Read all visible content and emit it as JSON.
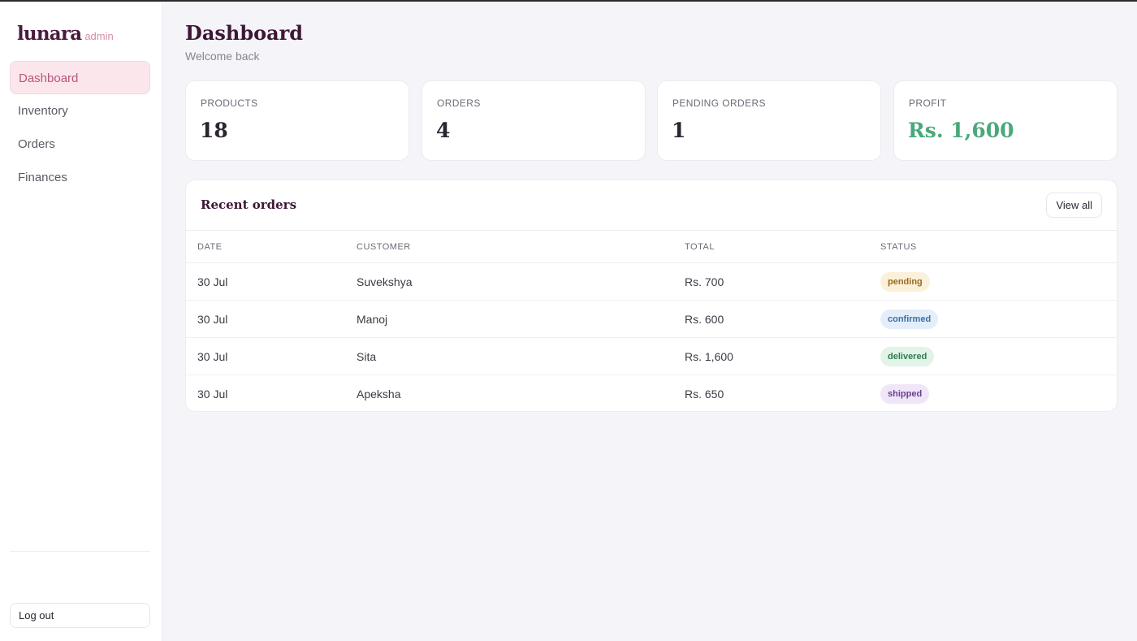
{
  "brand": {
    "name": "lunara",
    "tag": "admin"
  },
  "sidebar": {
    "items": [
      {
        "label": "Dashboard",
        "active": true
      },
      {
        "label": "Inventory",
        "active": false
      },
      {
        "label": "Orders",
        "active": false
      },
      {
        "label": "Finances",
        "active": false
      }
    ],
    "logout_label": "Log out"
  },
  "header": {
    "title": "Dashboard",
    "subtitle": "Welcome back"
  },
  "stats": [
    {
      "label": "PRODUCTS",
      "value": "18"
    },
    {
      "label": "ORDERS",
      "value": "4"
    },
    {
      "label": "PENDING ORDERS",
      "value": "1"
    },
    {
      "label": "PROFIT",
      "value": "Rs. 1,600",
      "color": "#4aa87a"
    }
  ],
  "recent_orders": {
    "title": "Recent orders",
    "view_all_label": "View all",
    "columns": [
      "DATE",
      "CUSTOMER",
      "TOTAL",
      "STATUS"
    ],
    "rows": [
      {
        "date": "30 Jul",
        "customer": "Suvekshya",
        "total": "Rs. 700",
        "status": "pending"
      },
      {
        "date": "30 Jul",
        "customer": "Manoj",
        "total": "Rs. 600",
        "status": "confirmed"
      },
      {
        "date": "30 Jul",
        "customer": "Sita",
        "total": "Rs. 1,600",
        "status": "delivered"
      },
      {
        "date": "30 Jul",
        "customer": "Apeksha",
        "total": "Rs. 650",
        "status": "shipped"
      }
    ]
  },
  "status_colors": {
    "pending": {
      "bg": "#fbf0d9",
      "fg": "#9a6a1e"
    },
    "confirmed": {
      "bg": "#e3eefa",
      "fg": "#3a6ea5"
    },
    "delivered": {
      "bg": "#e2f3e8",
      "fg": "#2f7a4e"
    },
    "shipped": {
      "bg": "#efe6f7",
      "fg": "#6b3f8f"
    }
  }
}
